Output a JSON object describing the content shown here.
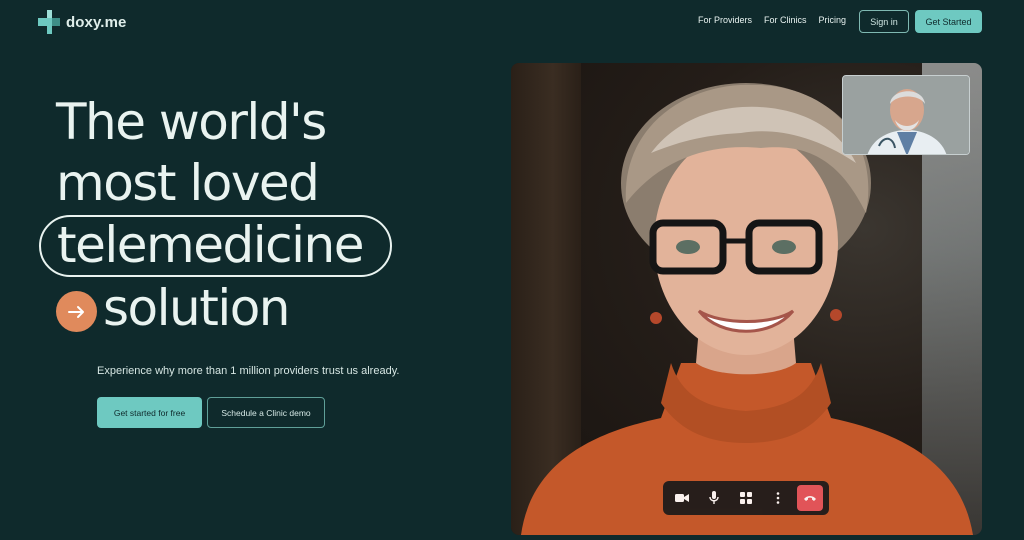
{
  "brand": {
    "name": "doxy.me",
    "accent": "#6ec9c1",
    "background": "#0f2a2c",
    "highlight": "#e08a5c"
  },
  "nav": {
    "links": [
      "For Providers",
      "For Clinics",
      "Pricing"
    ],
    "sign_in": "Sign in",
    "get_started": "Get Started"
  },
  "hero": {
    "line1": "The world's",
    "line2": "most loved",
    "line3": "telemedicine",
    "line4": "solution",
    "subtext": "Experience why more than 1 million providers trust us already.",
    "cta_primary": "Get started for free",
    "cta_secondary": "Schedule a Clinic demo"
  },
  "video_call": {
    "toolbar": [
      "camera-icon",
      "microphone-icon",
      "apps-icon",
      "more-vertical-icon",
      "end-call-icon"
    ],
    "end_call_color": "#e4545c"
  }
}
